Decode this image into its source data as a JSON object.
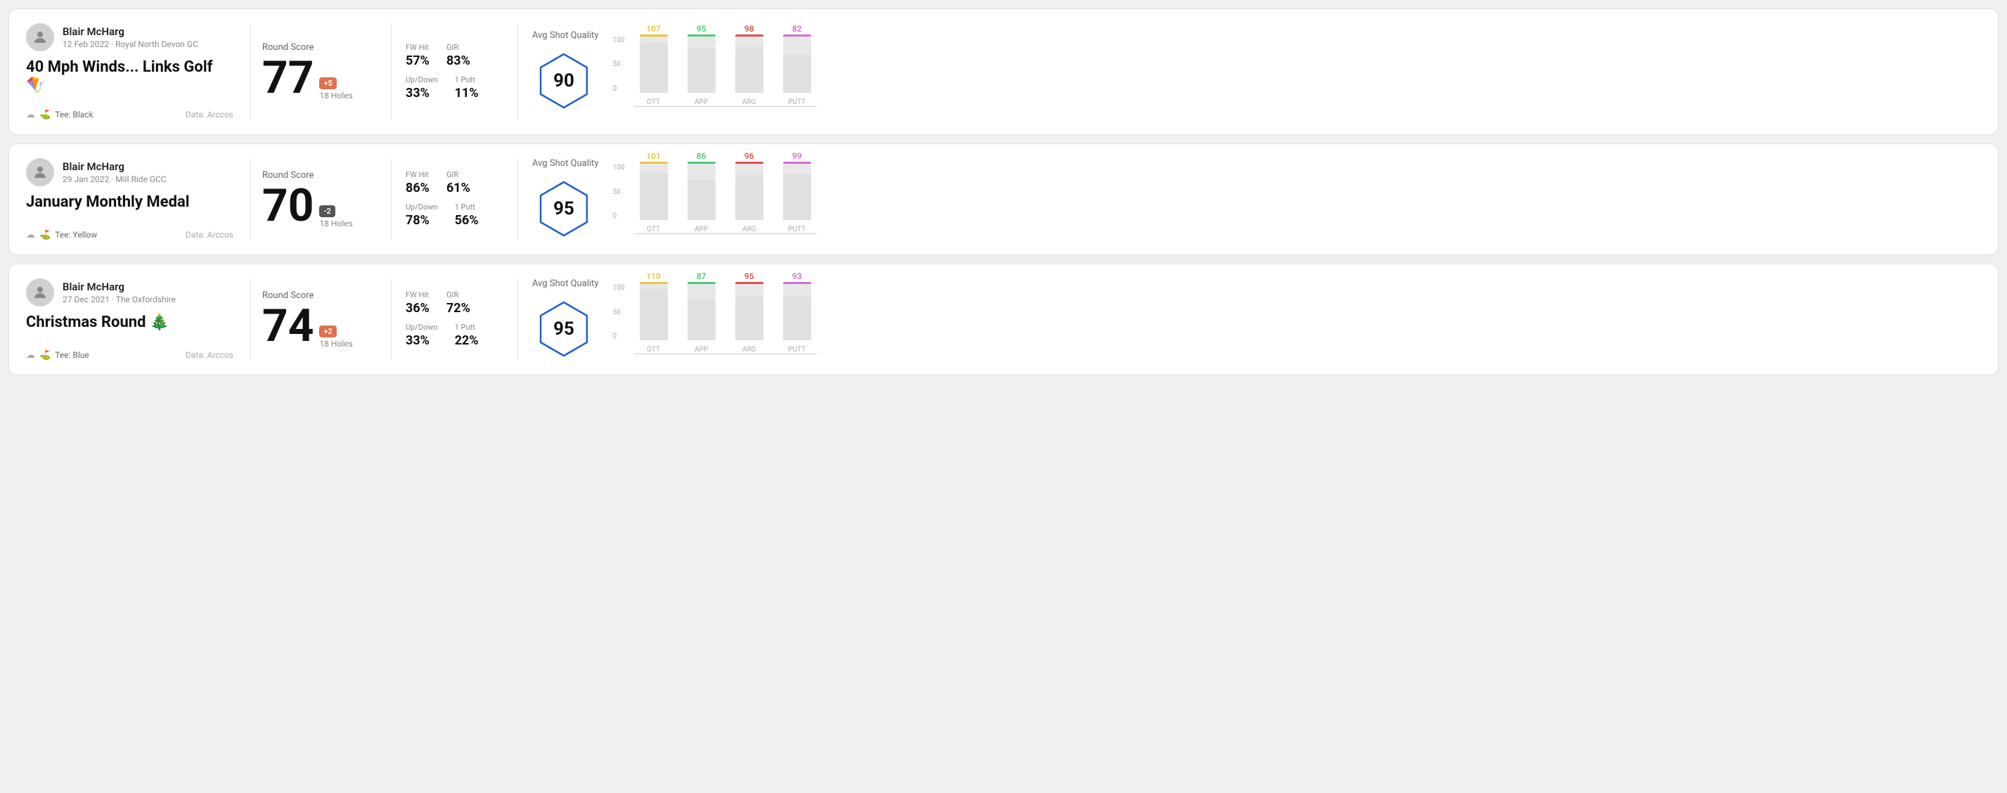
{
  "rounds": [
    {
      "id": "round1",
      "user": {
        "name": "Blair McHarg",
        "date": "12 Feb 2022",
        "course": "Royal North Devon GC"
      },
      "title": "40 Mph Winds... Links Golf 🪁",
      "tee": "Black",
      "data_source": "Data: Arccos",
      "score": {
        "label": "Round Score",
        "value": "77",
        "badge": "+5",
        "badge_type": "positive",
        "holes": "18 Holes"
      },
      "stats": {
        "fw_hit_label": "FW Hit",
        "fw_hit_value": "57%",
        "gir_label": "GIR",
        "gir_value": "83%",
        "updown_label": "Up/Down",
        "updown_value": "33%",
        "oneputt_label": "1 Putt",
        "oneputt_value": "11%"
      },
      "shot_quality": {
        "label": "Avg Shot Quality",
        "score": "90",
        "bars": [
          {
            "label": "OTT",
            "value": 107,
            "color": "#e8c440",
            "fill_pct": 75
          },
          {
            "label": "APP",
            "value": 95,
            "color": "#50c878",
            "fill_pct": 65
          },
          {
            "label": "ARG",
            "value": 98,
            "color": "#e05050",
            "fill_pct": 68
          },
          {
            "label": "PUTT",
            "value": 82,
            "color": "#d070d0",
            "fill_pct": 55
          }
        ]
      }
    },
    {
      "id": "round2",
      "user": {
        "name": "Blair McHarg",
        "date": "29 Jan 2022",
        "course": "Mill Ride GCC"
      },
      "title": "January Monthly Medal",
      "tee": "Yellow",
      "data_source": "Data: Arccos",
      "score": {
        "label": "Round Score",
        "value": "70",
        "badge": "-2",
        "badge_type": "negative",
        "holes": "18 Holes"
      },
      "stats": {
        "fw_hit_label": "FW Hit",
        "fw_hit_value": "86%",
        "gir_label": "GIR",
        "gir_value": "61%",
        "updown_label": "Up/Down",
        "updown_value": "78%",
        "oneputt_label": "1 Putt",
        "oneputt_value": "56%"
      },
      "shot_quality": {
        "label": "Avg Shot Quality",
        "score": "95",
        "bars": [
          {
            "label": "OTT",
            "value": 101,
            "color": "#e8c440",
            "fill_pct": 72
          },
          {
            "label": "APP",
            "value": 86,
            "color": "#50c878",
            "fill_pct": 60
          },
          {
            "label": "ARG",
            "value": 96,
            "color": "#e05050",
            "fill_pct": 67
          },
          {
            "label": "PUTT",
            "value": 99,
            "color": "#d070d0",
            "fill_pct": 70
          }
        ]
      }
    },
    {
      "id": "round3",
      "user": {
        "name": "Blair McHarg",
        "date": "27 Dec 2021",
        "course": "The Oxfordshire"
      },
      "title": "Christmas Round 🎄",
      "tee": "Blue",
      "data_source": "Data: Arccos",
      "score": {
        "label": "Round Score",
        "value": "74",
        "badge": "+2",
        "badge_type": "positive",
        "holes": "18 Holes"
      },
      "stats": {
        "fw_hit_label": "FW Hit",
        "fw_hit_value": "36%",
        "gir_label": "GIR",
        "gir_value": "72%",
        "updown_label": "Up/Down",
        "updown_value": "33%",
        "oneputt_label": "1 Putt",
        "oneputt_value": "22%"
      },
      "shot_quality": {
        "label": "Avg Shot Quality",
        "score": "95",
        "bars": [
          {
            "label": "OTT",
            "value": 110,
            "color": "#e8c440",
            "fill_pct": 78
          },
          {
            "label": "APP",
            "value": 87,
            "color": "#50c878",
            "fill_pct": 61
          },
          {
            "label": "ARG",
            "value": 95,
            "color": "#e05050",
            "fill_pct": 66
          },
          {
            "label": "PUTT",
            "value": 93,
            "color": "#d070d0",
            "fill_pct": 65
          }
        ]
      }
    }
  ],
  "y_axis": {
    "labels": [
      "100",
      "50",
      "0"
    ]
  }
}
